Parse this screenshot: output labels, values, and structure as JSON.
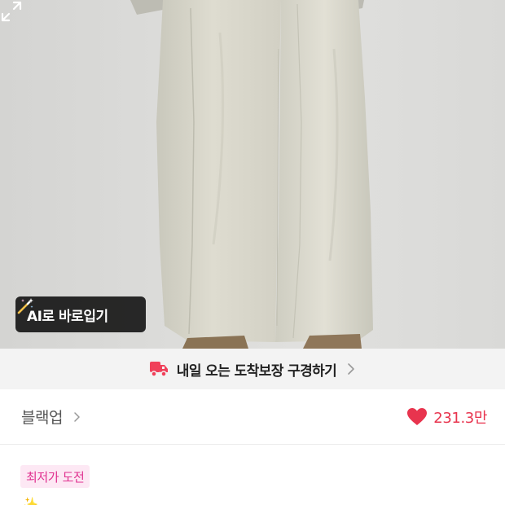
{
  "product_image": {
    "ai_button_label": "AI로 바로입기",
    "icons": {
      "ai": "magic-wand-icon",
      "expand": "expand-icon"
    }
  },
  "delivery_banner": {
    "text": "내일 오는 도착보장 구경하기",
    "icon": "truck-icon"
  },
  "store": {
    "name": "블랙업",
    "likes": "231.3만",
    "heart_color": "#e8344e"
  },
  "badge": {
    "label": "최저가 도전"
  },
  "title": {
    "partial_text": "… … … … … … … …"
  },
  "colors": {
    "accent": "#e8344e",
    "badge_text": "#e0308f",
    "badge_bg": "#fde8f4",
    "banner_bg": "#f3f3f3"
  }
}
